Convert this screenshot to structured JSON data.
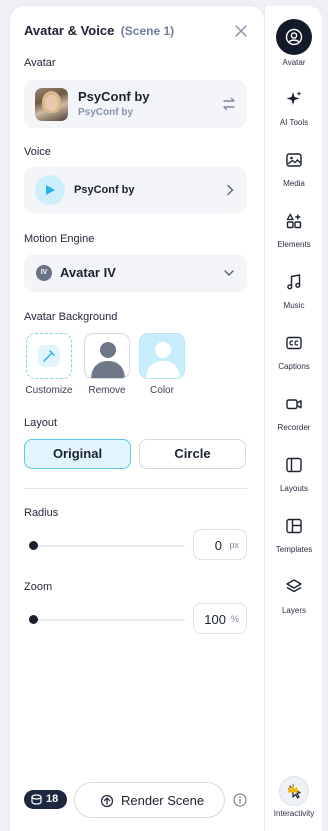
{
  "panel": {
    "title": "Avatar & Voice",
    "scene": "(Scene 1)"
  },
  "avatar": {
    "label": "Avatar",
    "name": "PsyConf by",
    "sub": "PsyConf by"
  },
  "voice": {
    "label": "Voice",
    "name": "PsyConf by"
  },
  "motion": {
    "label": "Motion Engine",
    "badge": "IV",
    "value": "Avatar IV"
  },
  "background": {
    "label": "Avatar Background",
    "options": [
      "Customize",
      "Remove",
      "Color"
    ]
  },
  "layout": {
    "label": "Layout",
    "options": [
      "Original",
      "Circle"
    ],
    "selected": "Original"
  },
  "radius": {
    "label": "Radius",
    "value": "0",
    "unit": "px",
    "level": 0
  },
  "zoom": {
    "label": "Zoom",
    "value": "100",
    "unit": "%",
    "level": 0
  },
  "footer": {
    "credits": "18",
    "render_label": "Render Scene"
  },
  "rail": {
    "items": [
      {
        "label": "Avatar",
        "icon": "avatar-icon"
      },
      {
        "label": "AI Tools",
        "icon": "sparkles-icon"
      },
      {
        "label": "Media",
        "icon": "image-icon"
      },
      {
        "label": "Elements",
        "icon": "shapes-icon"
      },
      {
        "label": "Music",
        "icon": "music-icon"
      },
      {
        "label": "Captions",
        "icon": "captions-icon"
      },
      {
        "label": "Recorder",
        "icon": "video-camera-icon"
      },
      {
        "label": "Layouts",
        "icon": "layout-icon"
      },
      {
        "label": "Templates",
        "icon": "template-icon"
      },
      {
        "label": "Layers",
        "icon": "layers-icon"
      },
      {
        "label": "Interactivity",
        "icon": "cursor-click-icon"
      }
    ]
  },
  "colors": {
    "accent": "#5cc7ec",
    "accent_soft": "#e0f5fc",
    "dark": "#131a29"
  }
}
